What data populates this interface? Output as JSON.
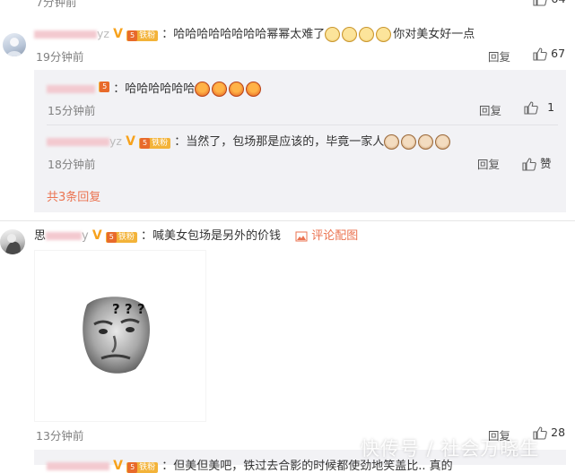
{
  "top_partial": {
    "time": "7分钟前",
    "like_count": "64"
  },
  "comment1": {
    "name_suffix": "yz",
    "text_before": "：哈哈哈哈哈哈哈哈幂幂太难了",
    "emoji_count": 4,
    "text_after": "你对美女好一点",
    "time": "19分钟前",
    "reply_label": "回复",
    "like_count": "67"
  },
  "replies": [
    {
      "text": "：哈哈哈哈哈哈",
      "emoji": "laugh",
      "emoji_count": 4,
      "time": "15分钟前",
      "reply_label": "回复",
      "like_label": "1"
    },
    {
      "name_suffix": "yz",
      "text": "：当然了，包场那是应该的，毕竟一家人",
      "emoji": "dog",
      "emoji_count": 4,
      "time": "18分钟前",
      "reply_label": "回复",
      "like_label": "赞"
    }
  ],
  "replies_total_label": "共3条回复",
  "comment2": {
    "name_start": "思",
    "name_end": "y",
    "text": "：喊美女包场是另外的价钱",
    "pic_link": "评论配图",
    "time": "13分钟前",
    "reply_label": "回复",
    "like_count": "28",
    "image_text": "? ? ?"
  },
  "comment3_partial": {
    "text": "：但美但美吧，铁过去合影的时候都使劲地笑盖比.. 真的"
  },
  "badge": {
    "fan_label": "铁粉",
    "level": "5",
    "vip_mark": "V"
  },
  "watermark": "快传号 / 社会万晓生",
  "colors": {
    "link_red": "#eb7350",
    "reply_bg": "#f2f2f5",
    "badge_orange": "#f3b339",
    "vip_orange": "#f7a21c"
  }
}
